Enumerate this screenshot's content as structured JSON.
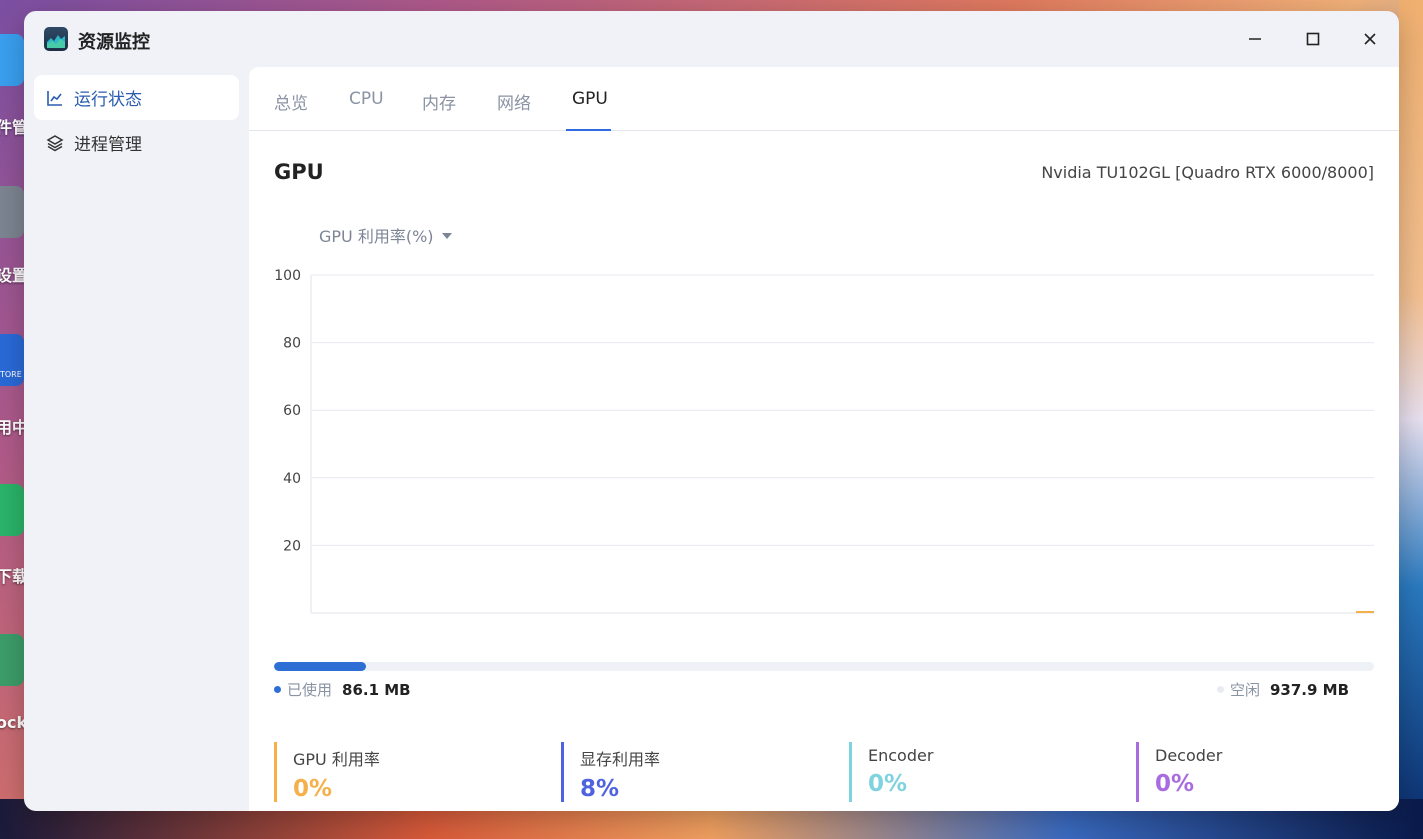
{
  "desktop": {
    "labels": [
      "件管",
      "设置",
      "用中",
      "下载",
      "ocke"
    ],
    "store_text": "TORE"
  },
  "window": {
    "title": "资源监控"
  },
  "sidebar": {
    "items": [
      {
        "label": "运行状态",
        "active": true
      },
      {
        "label": "进程管理",
        "active": false
      }
    ]
  },
  "tabs": [
    {
      "label": "总览"
    },
    {
      "label": "CPU"
    },
    {
      "label": "内存"
    },
    {
      "label": "网络"
    },
    {
      "label": "GPU",
      "active": true
    }
  ],
  "gpu": {
    "title": "GPU",
    "model": "Nvidia TU102GL [Quadro RTX 6000/8000]",
    "metric_selector": "GPU 利用率(%)"
  },
  "chart_data": {
    "type": "line",
    "title": "",
    "xlabel": "",
    "ylabel": "GPU 利用率(%)",
    "ylim": [
      0,
      100
    ],
    "yticks": [
      "100",
      "80",
      "60",
      "40",
      "20"
    ],
    "grid": true,
    "series": [
      {
        "color": "#f5b04a",
        "values": [
          0,
          0
        ]
      }
    ]
  },
  "memory": {
    "used_label": "已使用",
    "used_value": "86.1 MB",
    "free_label": "空闲",
    "free_value": "937.9 MB",
    "used_fraction": 0.084,
    "used_color": "#2e6fd6",
    "free_color": "#e8ebf0"
  },
  "stats": [
    {
      "label": "GPU 利用率",
      "value": "0%",
      "color": "#f5b04a"
    },
    {
      "label": "显存利用率",
      "value": "8%",
      "color": "#4f63e0"
    },
    {
      "label": "Encoder",
      "value": "0%",
      "color": "#7fd3df"
    },
    {
      "label": "Decoder",
      "value": "0%",
      "color": "#a86be0"
    }
  ]
}
